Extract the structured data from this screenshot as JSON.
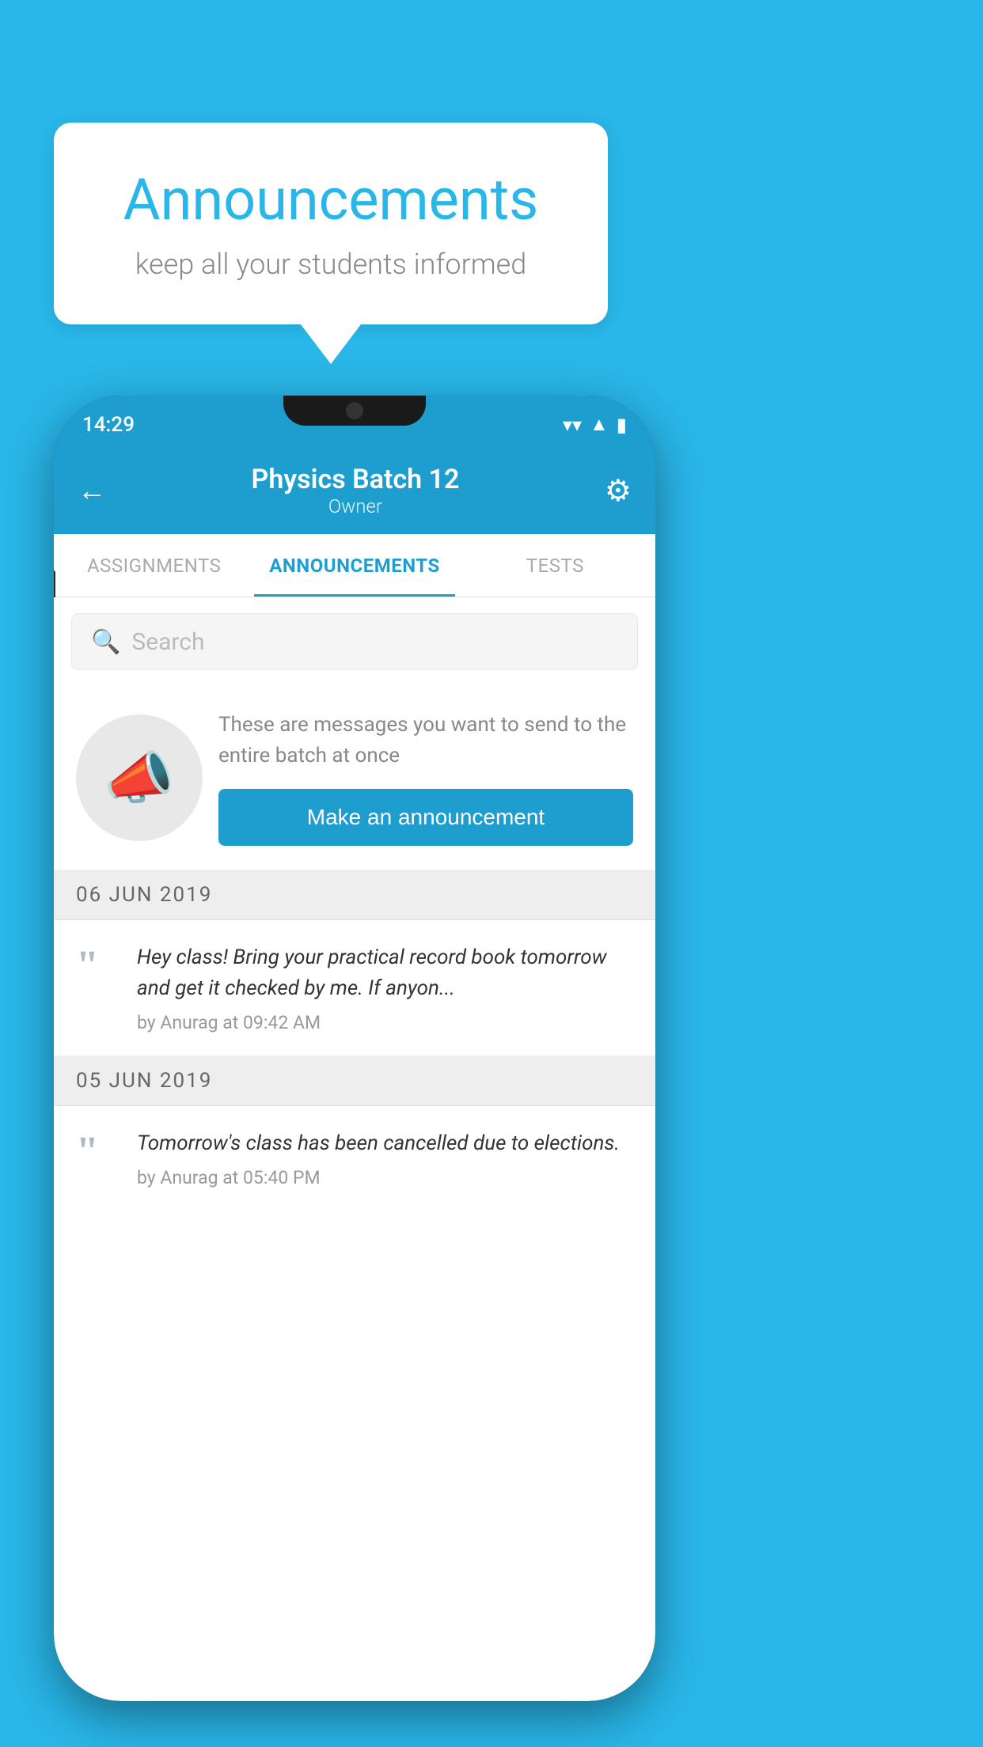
{
  "background_color": "#29b6e8",
  "speech_bubble": {
    "title": "Announcements",
    "subtitle": "keep all your students informed"
  },
  "phone": {
    "status_bar": {
      "time": "14:29",
      "wifi": "▼",
      "signal": "▲",
      "battery": "▮"
    },
    "header": {
      "back_label": "←",
      "title": "Physics Batch 12",
      "subtitle": "Owner",
      "settings_label": "⚙"
    },
    "tabs": [
      {
        "label": "ASSIGNMENTS",
        "active": false
      },
      {
        "label": "ANNOUNCEMENTS",
        "active": true
      },
      {
        "label": "TESTS",
        "active": false
      }
    ],
    "search": {
      "placeholder": "Search"
    },
    "promo": {
      "description": "These are messages you want to send to the entire batch at once",
      "button_label": "Make an announcement"
    },
    "announcements": [
      {
        "date": "06  JUN  2019",
        "message": "Hey class! Bring your practical record book tomorrow and get it checked by me. If anyon...",
        "author": "by Anurag at 09:42 AM"
      },
      {
        "date": "05  JUN  2019",
        "message": "Tomorrow's class has been cancelled due to elections.",
        "author": "by Anurag at 05:40 PM"
      }
    ]
  }
}
